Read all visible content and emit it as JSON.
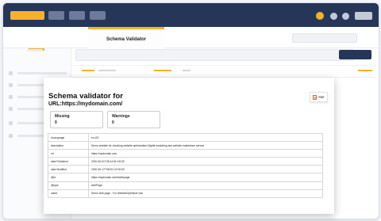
{
  "header": {
    "active_tab": "Schema Validator"
  },
  "report": {
    "title": "Schema validator for",
    "url": "URL:https://mydomain.com/",
    "pdf_label": "PDF",
    "stats": {
      "missing_label": "Missing",
      "missing_value": "0",
      "warnings_label": "Warnings",
      "warnings_value": "0"
    },
    "rows": [
      {
        "key": "inLanguage",
        "value": "en-US"
      },
      {
        "key": "description",
        "value": "Demo website for checking website optimization,Digital marketing and website maintaince service"
      },
      {
        "key": "url",
        "value": "https://mydomain.com"
      },
      {
        "key": "date Published",
        "value": "2020-06-01T08:14:51+00:00"
      },
      {
        "key": "date Modified",
        "value": "2020-06-17T08:00:14+00:00"
      },
      {
        "key": "@id",
        "value": "https://mydomain.com/#webpage"
      },
      {
        "key": "@type",
        "value": "webPage"
      },
      {
        "key": "name",
        "value": "Demo web page - For WebsiteOptimizer tool"
      }
    ]
  },
  "colors": {
    "navy": "#253659",
    "accent": "#f6b12a",
    "border": "#d4d7dc"
  }
}
